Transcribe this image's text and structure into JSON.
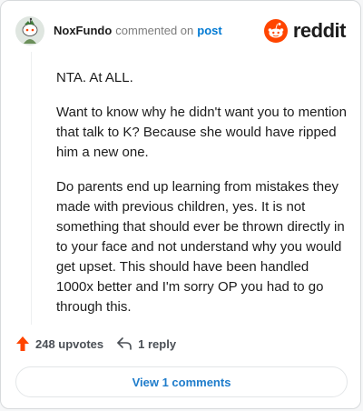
{
  "header": {
    "author": "NoxFundo",
    "commented_text": "commented on",
    "post_link": "post",
    "brand": "reddit"
  },
  "comment": {
    "paragraphs": [
      "NTA. At ALL.",
      "Want to know why he didn't want you to mention that talk to K? Because she would have ripped him a new one.",
      "Do parents end up learning from mistakes they made with previous children, yes. It is not something that should ever be thrown directly in to your face and not understand why you would get upset. This should have been handled 1000x better and I'm sorry OP you had to go through this."
    ]
  },
  "actions": {
    "upvotes_label": "248 upvotes",
    "reply_label": "1 reply"
  },
  "footer": {
    "view_comments_label": "View 1 comments"
  },
  "colors": {
    "accent": "#0079d3",
    "upvote": "#ff4500",
    "reddit_orange": "#ff4500",
    "view_link": "#1e7ccb"
  },
  "icons": {
    "avatar": "snoo-avatar-icon",
    "brand_logo": "reddit-logo-icon",
    "upvote": "upvote-arrow-icon",
    "reply": "reply-arrow-icon"
  }
}
